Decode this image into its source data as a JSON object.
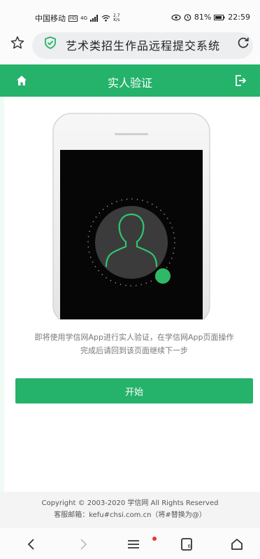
{
  "status_bar": {
    "carrier": "中国移动",
    "hd_badge": "HD",
    "network": "4G",
    "speed_value": "2.7",
    "speed_unit": "K/s",
    "battery": "81%",
    "time": "22:59"
  },
  "browser": {
    "page_title": "艺术类招生作品远程提交系统"
  },
  "header": {
    "title": "实人验证"
  },
  "main": {
    "instruction_line1": "即将使用学信网App进行实人验证，在学信网App页面操作",
    "instruction_line2": "完成后请回到该页面继续下一步",
    "start_label": "开始"
  },
  "footer": {
    "copyright": "Copyright © 2003-2020 学信网 All Rights Reserved",
    "contact": "客服邮箱：kefu#chsi.com.cn（将#替换为@）"
  },
  "colors": {
    "brand_green": "#25b26a",
    "notification_dot": "#e53935"
  },
  "icons": {
    "home": "home-icon",
    "logout": "logout-icon",
    "star": "star-icon",
    "shield": "shield-icon",
    "reload": "reload-icon",
    "back": "back-icon",
    "forward": "forward-icon",
    "menu": "menu-icon",
    "tabs": "tabs-icon",
    "home_nav": "home-nav-icon"
  }
}
